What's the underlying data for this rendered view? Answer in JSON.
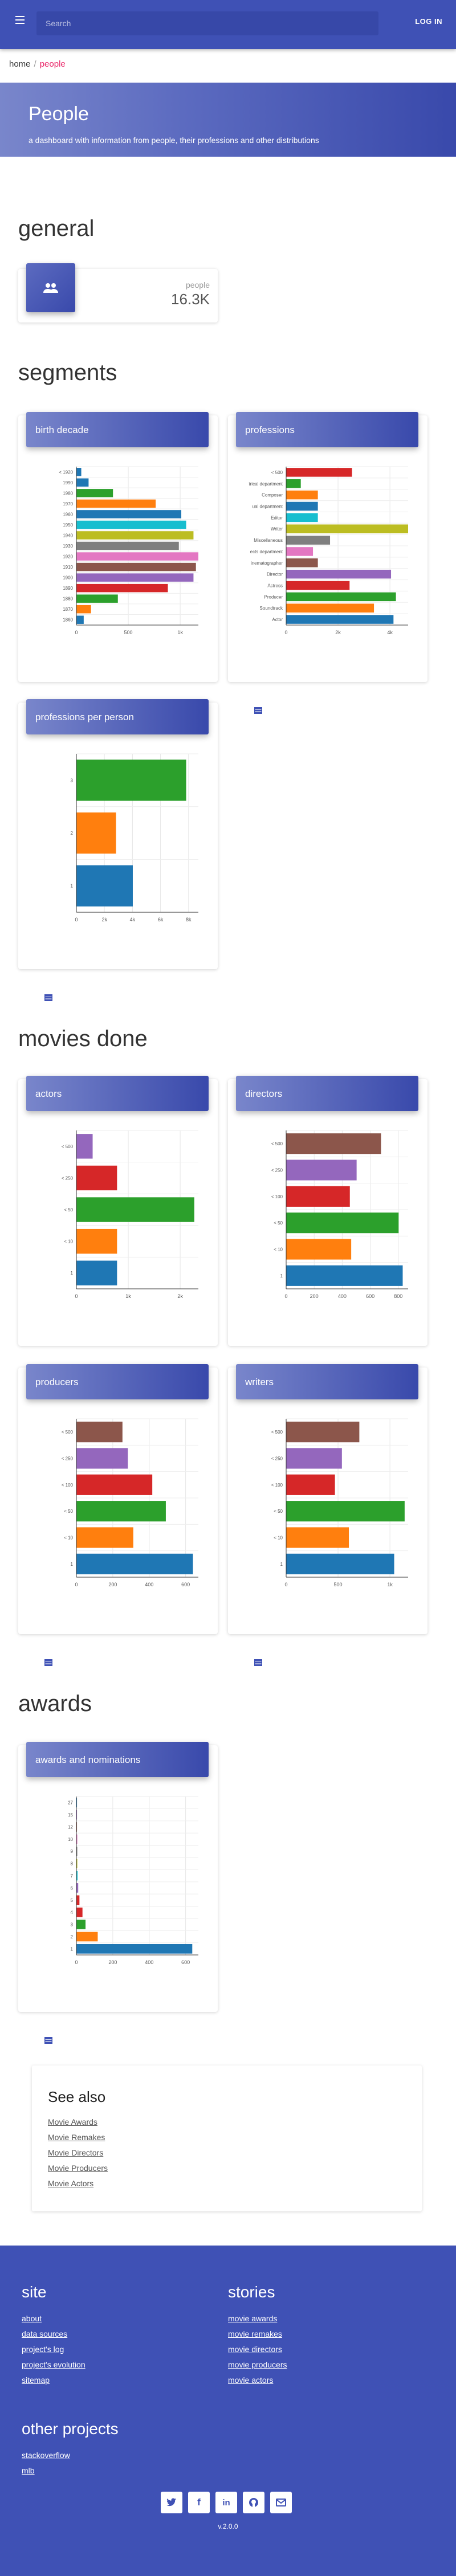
{
  "header": {
    "search_placeholder": "Search",
    "login_label": "LOG IN"
  },
  "breadcrumb": {
    "home": "home",
    "current": "people"
  },
  "hero": {
    "title": "People",
    "subtitle": "a dashboard with information from people, their professions and other distributions"
  },
  "sections": {
    "general": "general",
    "segments": "segments",
    "movies": "movies done",
    "awards": "awards"
  },
  "stat": {
    "label": "people",
    "value": "16.3K",
    "icon": "people-icon"
  },
  "cards": {
    "birth": "birth decade",
    "professions": "professions",
    "ppp": "professions per person",
    "actors": "actors",
    "directors": "directors",
    "producers": "producers",
    "writers": "writers",
    "awards": "awards and nominations"
  },
  "chart_data": [
    {
      "id": "birth",
      "type": "bar",
      "orientation": "horizontal",
      "categories": [
        "< 1920",
        "1990",
        "1980",
        "1970",
        "1960",
        "1950",
        "1940",
        "1930",
        "1920",
        "1910",
        "1900",
        "1890",
        "1880",
        "1870",
        "1860"
      ],
      "values": [
        40,
        100,
        300,
        650,
        860,
        900,
        960,
        840,
        1000,
        980,
        960,
        750,
        340,
        120,
        60
      ],
      "colors": [
        "#1f77b4",
        "#1f77b4",
        "#2ca02c",
        "#ff7f0e",
        "#1f77b4",
        "#17becf",
        "#bcbd22",
        "#7f7f7f",
        "#e377c2",
        "#8c564b",
        "#9467bd",
        "#d62728",
        "#2ca02c",
        "#ff7f0e",
        "#1f77b4"
      ],
      "xticks": [
        "0",
        "500",
        "1k"
      ],
      "xmax": 1000
    },
    {
      "id": "professions",
      "type": "bar",
      "orientation": "horizontal",
      "categories": [
        "< 500",
        "trical department",
        "Composer",
        "ual department",
        "Editor",
        "Writer",
        "Miscellaneous",
        "ects department",
        "inematographer",
        "Director",
        "Actress",
        "Producer",
        "Soundtrack",
        "Actor"
      ],
      "values": [
        2700,
        600,
        1300,
        1300,
        1300,
        5000,
        1800,
        1100,
        1300,
        4300,
        2600,
        4500,
        3600,
        4400
      ],
      "colors": [
        "#d62728",
        "#2ca02c",
        "#ff7f0e",
        "#1f77b4",
        "#17becf",
        "#bcbd22",
        "#7f7f7f",
        "#e377c2",
        "#8c564b",
        "#9467bd",
        "#d62728",
        "#2ca02c",
        "#ff7f0e",
        "#1f77b4"
      ],
      "xticks": [
        "0",
        "2k",
        "4k"
      ],
      "xmax": 5000
    },
    {
      "id": "ppp",
      "type": "bar",
      "orientation": "horizontal",
      "categories": [
        "3",
        "2",
        "1"
      ],
      "values": [
        7200,
        2600,
        3700
      ],
      "colors": [
        "#2ca02c",
        "#ff7f0e",
        "#1f77b4"
      ],
      "xticks": [
        "0",
        "2k",
        "4k",
        "6k",
        "8k"
      ],
      "xmax": 8000
    },
    {
      "id": "actors",
      "type": "bar",
      "orientation": "horizontal",
      "categories": [
        "< 500",
        "< 250",
        "< 50",
        "< 10",
        "1"
      ],
      "values": [
        400,
        1000,
        2900,
        1000,
        1000
      ],
      "colors": [
        "#9467bd",
        "#d62728",
        "#2ca02c",
        "#ff7f0e",
        "#1f77b4"
      ],
      "xticks": [
        "0",
        "1k",
        "2k"
      ],
      "xmax": 3000
    },
    {
      "id": "directors",
      "type": "bar",
      "orientation": "horizontal",
      "categories": [
        "< 500",
        "< 250",
        "< 100",
        "< 50",
        "< 10",
        "1"
      ],
      "values": [
        700,
        520,
        470,
        830,
        480,
        860
      ],
      "colors": [
        "#8c564b",
        "#9467bd",
        "#d62728",
        "#2ca02c",
        "#ff7f0e",
        "#1f77b4"
      ],
      "xticks": [
        "0",
        "200",
        "400",
        "600",
        "800"
      ],
      "xmax": 900
    },
    {
      "id": "producers",
      "type": "bar",
      "orientation": "horizontal",
      "categories": [
        "< 500",
        "< 250",
        "< 100",
        "< 50",
        "< 10",
        "1"
      ],
      "values": [
        340,
        380,
        560,
        660,
        420,
        860
      ],
      "colors": [
        "#8c564b",
        "#9467bd",
        "#d62728",
        "#2ca02c",
        "#ff7f0e",
        "#1f77b4"
      ],
      "xticks": [
        "0",
        "200",
        "400",
        "600"
      ],
      "xmax": 900
    },
    {
      "id": "writers",
      "type": "bar",
      "orientation": "horizontal",
      "categories": [
        "< 500",
        "< 250",
        "< 100",
        "< 50",
        "< 10",
        "1"
      ],
      "values": [
        630,
        480,
        420,
        1020,
        540,
        930
      ],
      "colors": [
        "#8c564b",
        "#9467bd",
        "#d62728",
        "#2ca02c",
        "#ff7f0e",
        "#1f77b4"
      ],
      "xticks": [
        "0",
        "500",
        "1k"
      ],
      "xmax": 1050
    },
    {
      "id": "awards",
      "type": "bar",
      "orientation": "horizontal",
      "categories": [
        "27",
        "15",
        "12",
        "10",
        "9",
        "8",
        "7",
        "6",
        "5",
        "4",
        "3",
        "2",
        "1"
      ],
      "values": [
        4,
        4,
        4,
        6,
        6,
        6,
        8,
        12,
        20,
        40,
        60,
        140,
        760
      ],
      "colors": [
        "#1f77b4",
        "#9467bd",
        "#8c564b",
        "#e377c2",
        "#7f7f7f",
        "#bcbd22",
        "#17becf",
        "#9467bd",
        "#d62728",
        "#d62728",
        "#2ca02c",
        "#ff7f0e",
        "#1f77b4"
      ],
      "xticks": [
        "0",
        "200",
        "400",
        "600"
      ],
      "xmax": 800
    }
  ],
  "see_also": {
    "title": "See also",
    "links": [
      "Movie Awards",
      "Movie Remakes",
      "Movie Directors",
      "Movie Producers",
      "Movie Actors"
    ]
  },
  "footer": {
    "site": {
      "title": "site",
      "links": [
        "about",
        "data sources",
        "project's log",
        "project's evolution",
        "sitemap"
      ]
    },
    "stories": {
      "title": "stories",
      "links": [
        "movie awards",
        "movie remakes",
        "movie directors",
        "movie producers",
        "movie actors"
      ]
    },
    "other": {
      "title": "other projects",
      "links": [
        "stackoverflow",
        "mlb"
      ]
    },
    "version": "v.2.0.0"
  }
}
